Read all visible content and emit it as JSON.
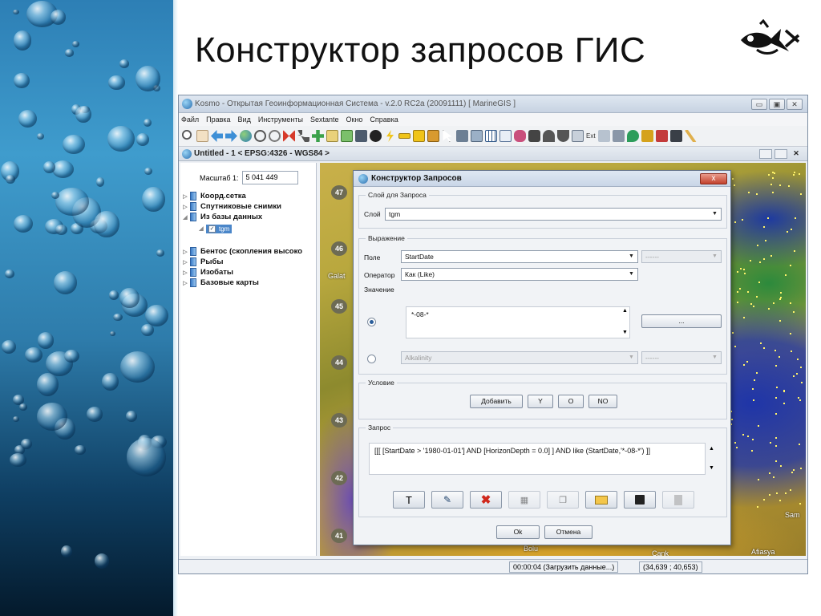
{
  "slide": {
    "title": "Конструктор запросов ГИС"
  },
  "app": {
    "window_title": "Kosmo - Открытая Геоинформационная Система - v.2.0 RC2a (20091111) [ MarineGIS ]",
    "menu": [
      "Файл",
      "Правка",
      "Вид",
      "Инструменты",
      "Sextante",
      "Окно",
      "Справка"
    ],
    "toolbar_ext_label": "Ext",
    "doc_title": "Untitled - 1 < EPSG:4326 - WGS84 >",
    "scale_label": "Масштаб 1:",
    "scale_value": "5 041 449",
    "tree": {
      "items": [
        {
          "label": "Коорд.сетка"
        },
        {
          "label": "Спутниковые снимки"
        },
        {
          "label": "Из базы данных"
        },
        {
          "label": "tgm"
        },
        {
          "label": "Бентос (скопления высоко"
        },
        {
          "label": "Рыбы"
        },
        {
          "label": "Изобаты"
        },
        {
          "label": "Базовые карты"
        }
      ]
    },
    "map": {
      "lat_labels": [
        "47",
        "46",
        "45",
        "44",
        "43",
        "42",
        "41"
      ],
      "place_labels": [
        "Galat",
        "Sam",
        "Cank",
        "Afiasya",
        "Bolu"
      ]
    },
    "status": {
      "time": "00:00:04 (Загрузить данные...)",
      "coords": "(34,639 ; 40,653)"
    }
  },
  "dialog": {
    "title": "Конструктор Запросов",
    "close": "x",
    "layer_group": "Слой для Запроса",
    "layer_label": "Слой",
    "layer_value": "tgm",
    "expr_group": "Выражение",
    "field_label": "Поле",
    "field_value": "StartDate",
    "field_secondary": "------",
    "operator_label": "Оператор",
    "operator_value": "Как (Like)",
    "value_label": "Значение",
    "value_text": "*-08-*",
    "browse_button": "...",
    "alt_field": "Alkalinity",
    "alt_field_secondary": "------",
    "condition_group": "Условие",
    "add_button": "Добавить",
    "and_button": "Y",
    "or_button": "O",
    "not_button": "NO",
    "query_group": "Запрос",
    "query_text": "[[[ [StartDate > '1980-01-01'] AND [HorizonDepth = 0.0] ] AND like (StartDate,'*-08-*') ]]",
    "ok_button": "Ok",
    "cancel_button": "Отмена"
  }
}
